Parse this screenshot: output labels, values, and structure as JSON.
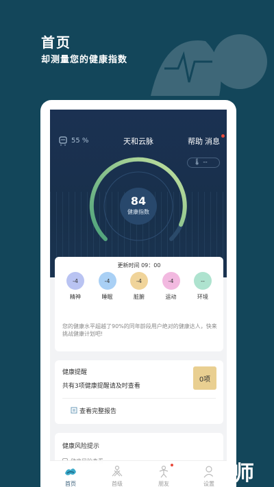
{
  "promo": {
    "title": "首页",
    "subtitle": "却测量您的健康指数"
  },
  "app": {
    "battery_text": "55 %",
    "title": "天和云脉",
    "help_label": "帮助",
    "message_label": "消息",
    "env_value": "--"
  },
  "score": {
    "value": "84",
    "label": "健康指数"
  },
  "update": {
    "time_text": "更新时间 09：00",
    "dimensions": [
      {
        "label": "精神",
        "value": "-4",
        "color": "#b9c3f2"
      },
      {
        "label": "睡眠",
        "value": "-4",
        "color": "#a9d0f5"
      },
      {
        "label": "脏腑",
        "value": "-4",
        "color": "#f0d49a"
      },
      {
        "label": "运动",
        "value": "-4",
        "color": "#f2b9e0"
      },
      {
        "label": "环境",
        "value": "--",
        "color": "#aee3cf"
      }
    ],
    "summary": "您的健康水平超越了90%的同年龄段用户绝对的健康达人，快来挑战健康计划吧!"
  },
  "reminder": {
    "title": "健康提醒",
    "desc": "共有3项健康提醒请及时查看",
    "badge": "0项",
    "report_link": "查看完整报告"
  },
  "risk": {
    "title": "健康风险提示",
    "row_text": "健康风险查看"
  },
  "tabs": [
    {
      "label": "首页",
      "icon": "home-icon"
    },
    {
      "label": "首级",
      "icon": "level-icon"
    },
    {
      "label": "朋友",
      "icon": "friends-icon"
    },
    {
      "label": "设置",
      "icon": "settings-icon"
    }
  ],
  "brand": {
    "text": "教师"
  },
  "colors": {
    "page_bg": "#13465a",
    "hero_bg": "#1b3152",
    "gauge_start": "#4ba17a",
    "gauge_end": "#c8e3a0",
    "badge_bg": "#e9cf91",
    "alert_dot": "#e84b3c"
  }
}
